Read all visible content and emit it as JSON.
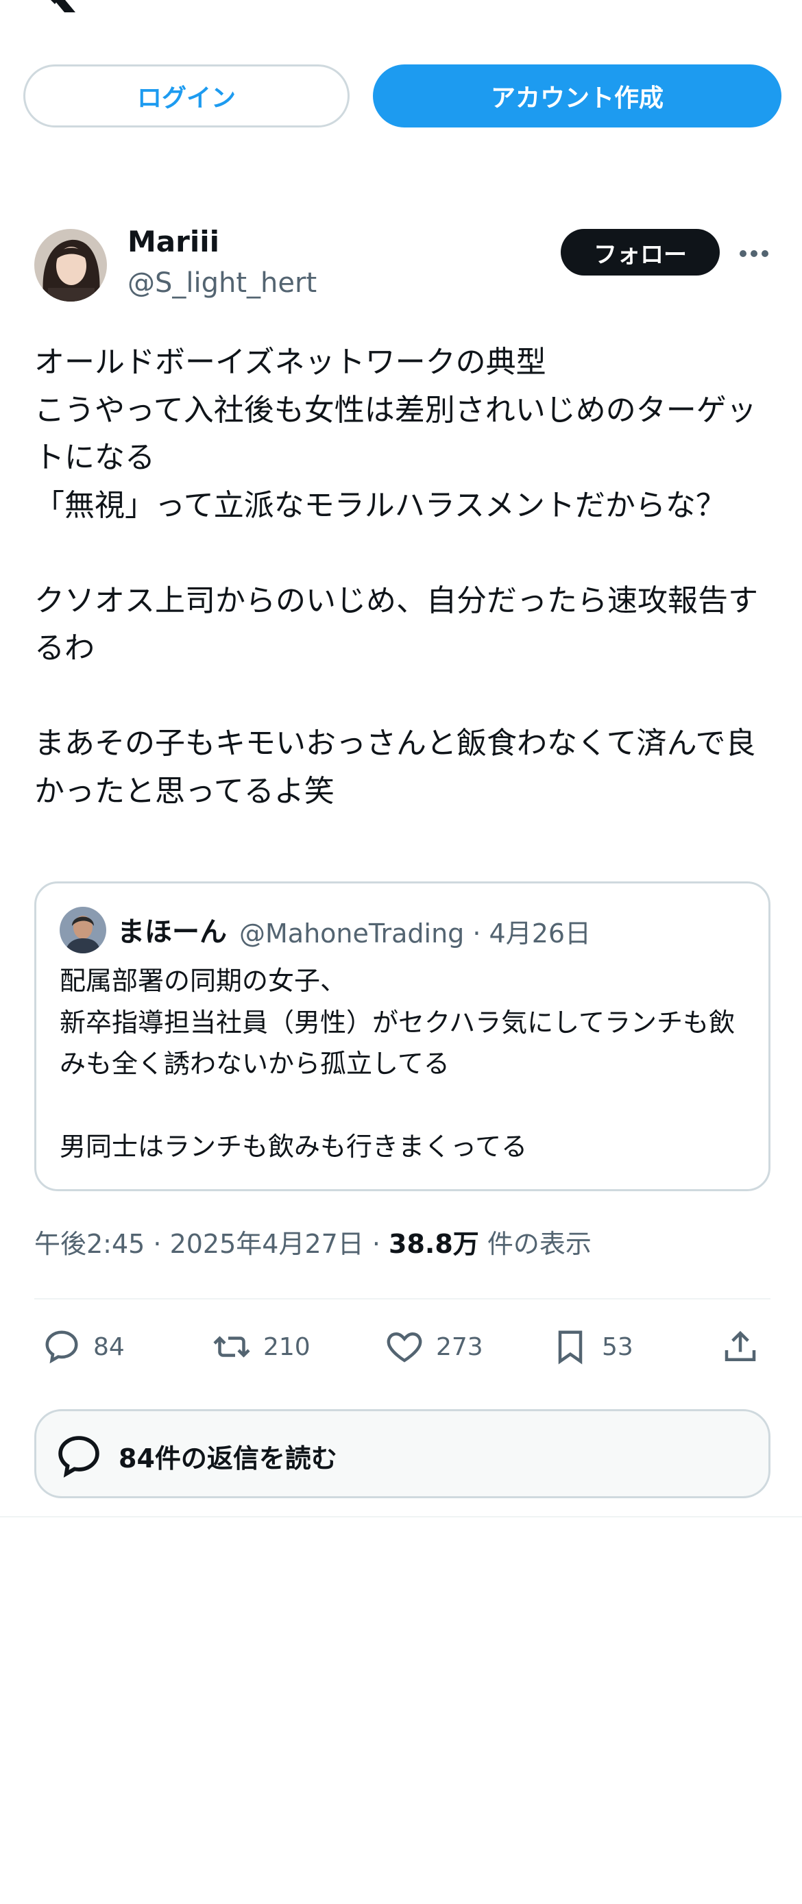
{
  "header": {
    "logo": "x-logo"
  },
  "auth": {
    "login_label": "ログイン",
    "signup_label": "アカウント作成"
  },
  "tweet": {
    "author": {
      "name": "Mariii",
      "handle": "@S_light_hert"
    },
    "follow_label": "フォロー",
    "text": "オールドボーイズネットワークの典型\nこうやって入社後も女性は差別されいじめのターゲットになる\n「無視」って立派なモラルハラスメントだからな？\n\nクソオス上司からのいじめ、自分だったら速攻報告するわ\n\nまあその子もキモいおっさんと飯食わなくて済んで良かったと思ってるよ笑",
    "quote": {
      "name": "まほーん",
      "meta": "@MahoneTrading · 4月26日",
      "text": "配属部署の同期の女子、\n新卒指導担当社員（男性）がセクハラ気にしてランチも飲みも全く誘わないから孤立してる\n\n男同士はランチも飲みも行きまくってる"
    },
    "timestamp": "午後2:45 · 2025年4月27日 · ",
    "views_count": "38.8万",
    "views_label": " 件の表示",
    "stats": {
      "replies": "84",
      "retweets": "210",
      "likes": "273",
      "bookmarks": "53"
    },
    "read_replies_label": "84件の返信を読む"
  },
  "colors": {
    "accent": "#1d9bf0",
    "text": "#0f1419",
    "muted": "#536471",
    "border": "#cfd9de"
  }
}
